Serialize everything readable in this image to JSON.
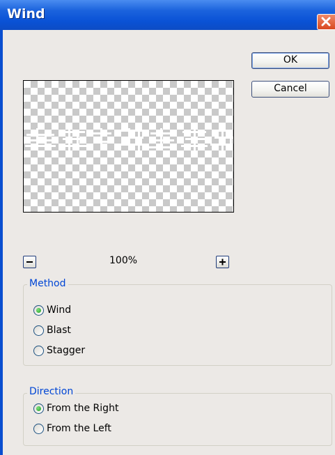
{
  "window": {
    "title": "Wind"
  },
  "buttons": {
    "ok": "OK",
    "cancel": "Cancel"
  },
  "preview": {
    "zoom": "100%",
    "decrease_label": "−",
    "increase_label": "+"
  },
  "method": {
    "legend": "Method",
    "options": [
      {
        "label": "Wind",
        "checked": true
      },
      {
        "label": "Blast",
        "checked": false
      },
      {
        "label": "Stagger",
        "checked": false
      }
    ]
  },
  "direction": {
    "legend": "Direction",
    "options": [
      {
        "label": "From the Right",
        "checked": true
      },
      {
        "label": "From the Left",
        "checked": false
      }
    ]
  },
  "colors": {
    "titlebar": "#0a52d6",
    "legend_text": "#0046d5",
    "dialog_bg": "#ece9e6"
  }
}
